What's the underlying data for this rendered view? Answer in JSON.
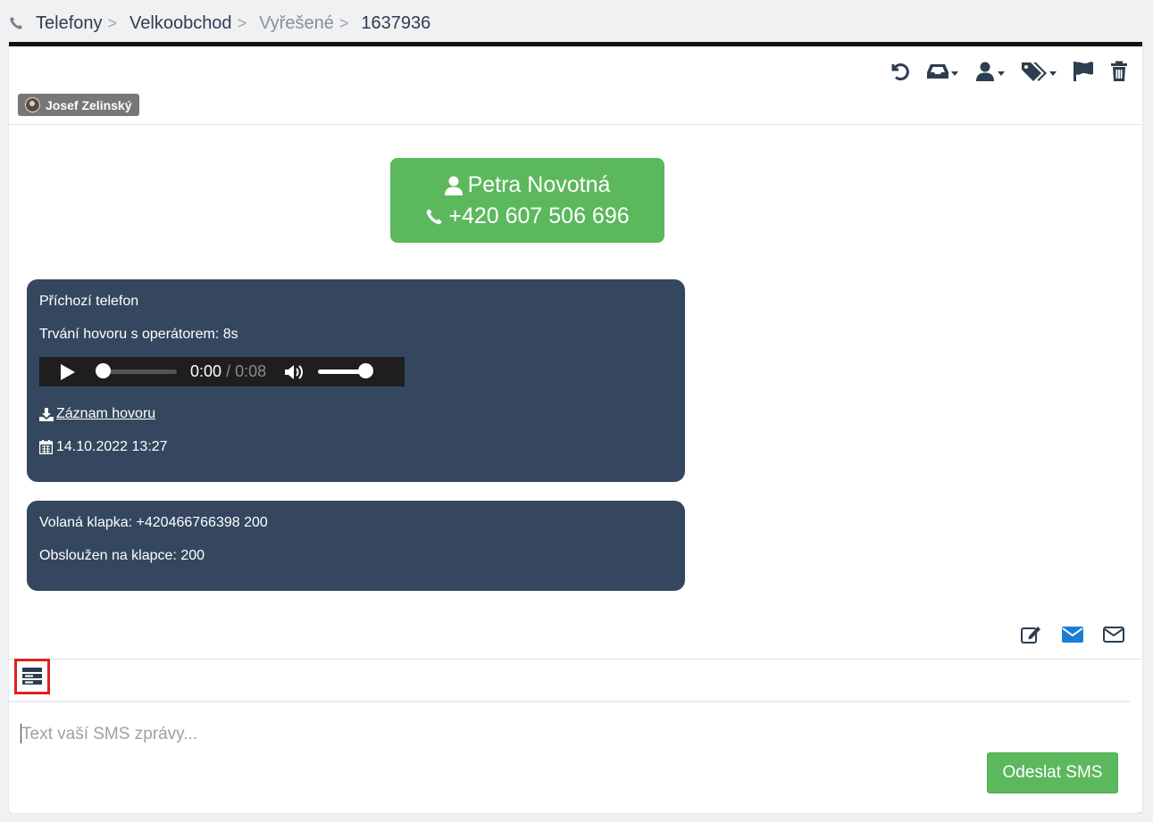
{
  "breadcrumb": {
    "items": [
      "Telefony",
      "Velkoobchod",
      "Vyřešené",
      "1637936"
    ],
    "separator": ">"
  },
  "toolbar": {
    "icons": [
      "undo-icon",
      "inbox-icon",
      "user-icon",
      "tags-icon",
      "flag-icon",
      "trash-icon"
    ]
  },
  "agent": {
    "name": "Josef Zelinský"
  },
  "contact": {
    "name": "Petra Novotná",
    "phone": "+420 607 506 696"
  },
  "message1": {
    "title": "Příchozí telefon",
    "duration": "Trvání hovoru s operátorem: 8s",
    "player": {
      "current": "0:00",
      "separator": "/",
      "total": "0:08"
    },
    "recording_link": "Záznam hovoru",
    "date": "14.10.2022 13:27"
  },
  "message2": {
    "line1": "Volaná klapka: +420466766398 200",
    "line2": "Obsloužen na klapce: 200"
  },
  "compose": {
    "placeholder": "Text vaší SMS zprávy...",
    "send_label": "Odeslat SMS"
  },
  "colors": {
    "accent_green": "#5cb85c",
    "message_bg": "#34475e",
    "icon_dark": "#2c3e50",
    "envelope_blue": "#1a7fd4"
  }
}
